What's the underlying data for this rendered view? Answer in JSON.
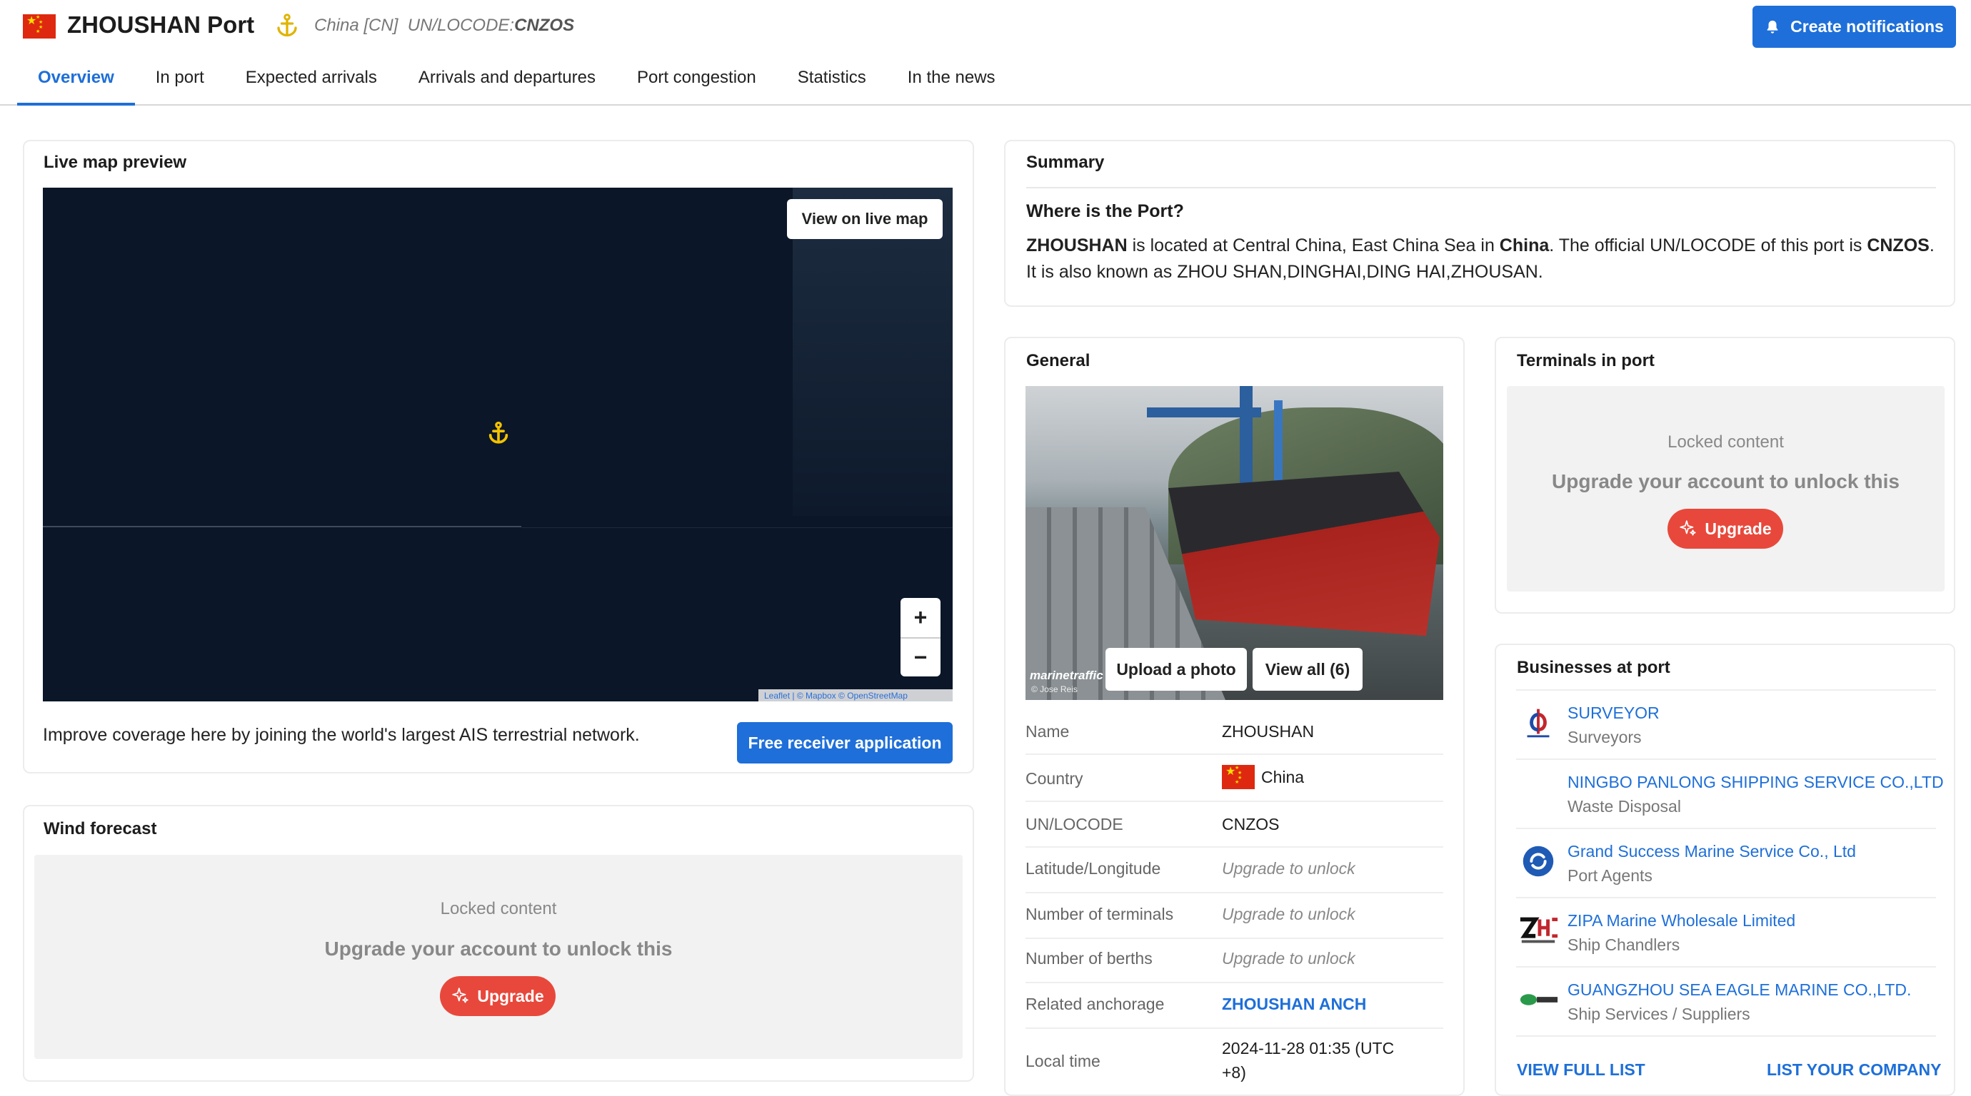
{
  "header": {
    "port_name": "ZHOUSHAN Port",
    "country": "China [CN]",
    "locode_label": "UN/LOCODE:",
    "locode": "CNZOS",
    "notify_button": "Create notifications"
  },
  "tabs": [
    "Overview",
    "In port",
    "Expected arrivals",
    "Arrivals and departures",
    "Port congestion",
    "Statistics",
    "In the news"
  ],
  "active_tab": "Overview",
  "map_card": {
    "title": "Live map preview",
    "view_button": "View on live map",
    "zoom_in": "+",
    "zoom_out": "−",
    "attribution": "Leaflet | © Mapbox © OpenStreetMap",
    "coverage_text": "Improve coverage here by joining the world's largest AIS terrestrial network.",
    "receiver_button": "Free receiver application"
  },
  "wind_card": {
    "title": "Wind forecast",
    "locked_title": "Locked content",
    "locked_text": "Upgrade your account to unlock this",
    "upgrade_button": "Upgrade"
  },
  "summary": {
    "title": "Summary",
    "question": "Where is the Port?",
    "p_name": "ZHOUSHAN",
    "p_text1": " is located at Central China, East China Sea in ",
    "p_country": "China",
    "p_text2": ". The official UN/LOCODE of this port is ",
    "p_locode": "CNZOS",
    "p_text3": ". It is also known as ZHOU SHAN,DINGHAI,DING HAI,ZHOUSAN."
  },
  "general": {
    "title": "General",
    "watermark": "marinetraffic",
    "photo_credit": "© Jose Reis",
    "upload_button": "Upload a photo",
    "view_all_button": "View all (6)",
    "rows": [
      {
        "label": "Name",
        "value": "ZHOUSHAN"
      },
      {
        "label": "Country",
        "value": "China"
      },
      {
        "label": "UN/LOCODE",
        "value": "CNZOS"
      },
      {
        "label": "Latitude/Longitude",
        "value": "Upgrade to unlock"
      },
      {
        "label": "Number of terminals",
        "value": "Upgrade to unlock"
      },
      {
        "label": "Number of berths",
        "value": "Upgrade to unlock"
      },
      {
        "label": "Related anchorage",
        "value": "ZHOUSHAN ANCH"
      },
      {
        "label": "Local time",
        "value_line1": "2024-11-28 01:35 (UTC",
        "value_line2": "+8)"
      }
    ]
  },
  "terminals": {
    "title": "Terminals in port",
    "locked_title": "Locked content",
    "locked_text": "Upgrade your account to unlock this",
    "upgrade_button": "Upgrade"
  },
  "businesses": {
    "title": "Businesses at port",
    "items": [
      {
        "name": "SURVEYOR",
        "category": "Surveyors"
      },
      {
        "name": "NINGBO PANLONG SHIPPING SERVICE CO.,LTD",
        "category": "Waste Disposal"
      },
      {
        "name": "Grand Success Marine Service Co., Ltd",
        "category": "Port Agents"
      },
      {
        "name": "ZIPA Marine Wholesale Limited",
        "category": "Ship Chandlers"
      },
      {
        "name": "GUANGZHOU SEA EAGLE MARINE CO.,LTD.",
        "category": "Ship Services / Suppliers"
      }
    ],
    "view_full_list": "VIEW FULL LIST",
    "list_company": "LIST YOUR COMPANY"
  },
  "colors": {
    "accent": "#1e6fd9",
    "upgrade": "#e8483b",
    "map_bg": "#0b1628"
  }
}
